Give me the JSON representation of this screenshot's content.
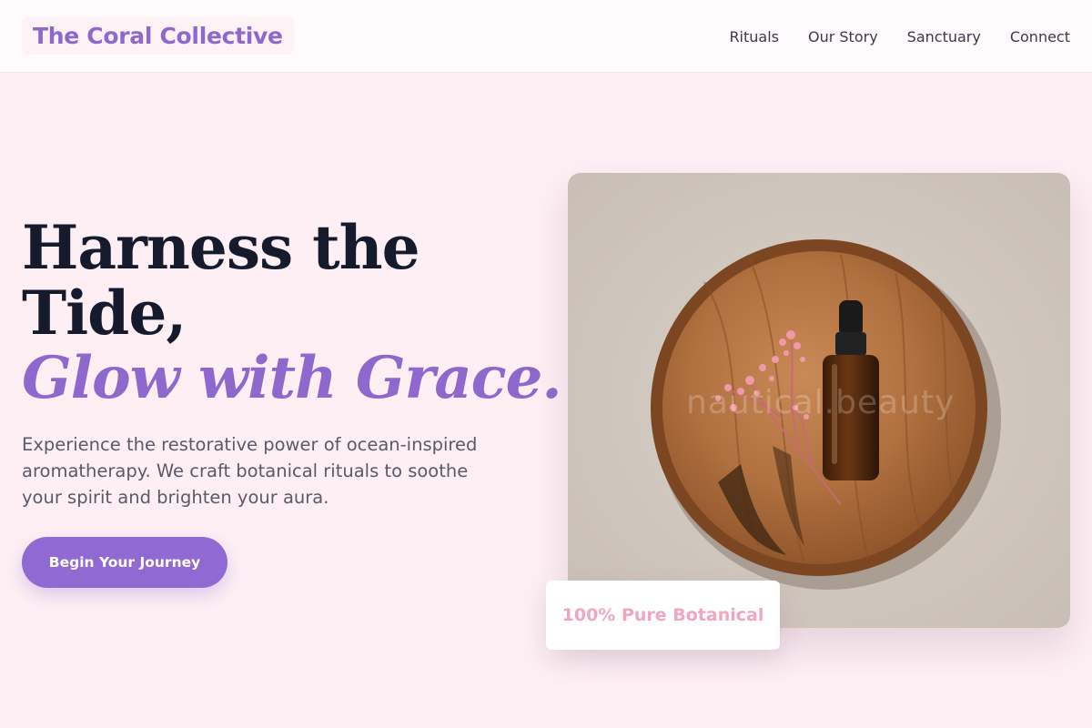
{
  "header": {
    "logo": "The Coral Collective",
    "nav": [
      "Rituals",
      "Our Story",
      "Sanctuary",
      "Connect"
    ]
  },
  "hero": {
    "headline_line1": "Harness the",
    "headline_line2": "Tide,",
    "headline_accent": "Glow with Grace.",
    "subtext": "Experience the restorative power of ocean-inspired aromatherapy. We craft botanical rituals to soothe your spirit and brighten your aura.",
    "cta_label": "Begin Your Journey"
  },
  "image": {
    "watermark": "nautical.beauty",
    "badge": "100% Pure Botanical"
  },
  "colors": {
    "background": "#fdeff4",
    "accent_purple": "#8e68cc",
    "heading": "#151a2d",
    "badge_pink": "#f0a6c2"
  }
}
